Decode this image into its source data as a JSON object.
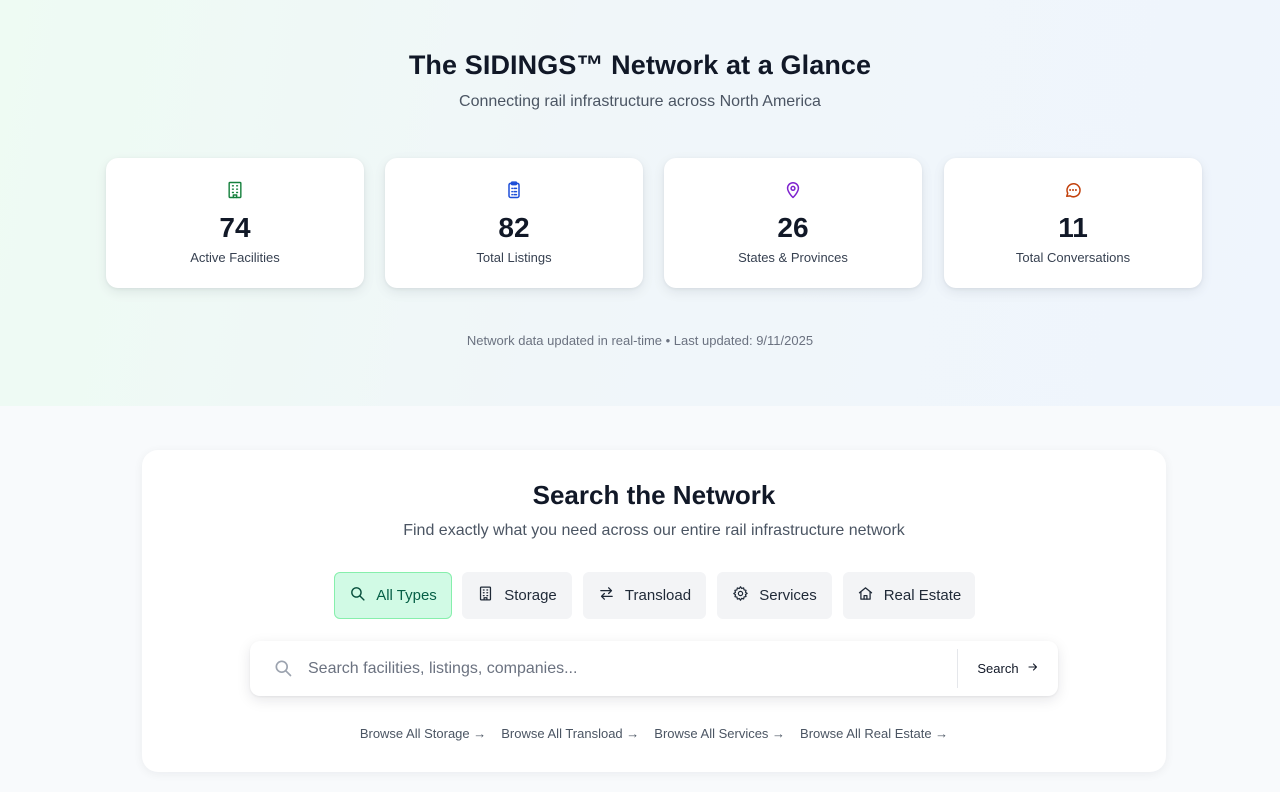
{
  "hero": {
    "title": "The SIDINGS™ Network at a Glance",
    "subtitle": "Connecting rail infrastructure across North America",
    "note": "Network data updated in real-time • Last updated: 9/11/2025",
    "stats": [
      {
        "value": "74",
        "label": "Active Facilities",
        "icon": "building-icon",
        "color": "#15803d"
      },
      {
        "value": "82",
        "label": "Total Listings",
        "icon": "clipboard-list-icon",
        "color": "#1d4ed8"
      },
      {
        "value": "26",
        "label": "States & Provinces",
        "icon": "map-pin-icon",
        "color": "#7e22ce"
      },
      {
        "value": "11",
        "label": "Total Conversations",
        "icon": "message-circle-icon",
        "color": "#c2410c"
      }
    ]
  },
  "search": {
    "title": "Search the Network",
    "subtitle": "Find exactly what you need across our entire rail infrastructure network",
    "types": [
      {
        "label": "All Types",
        "icon": "search-icon",
        "active": true
      },
      {
        "label": "Storage",
        "icon": "building-icon",
        "active": false
      },
      {
        "label": "Transload",
        "icon": "arrows-exchange-icon",
        "active": false
      },
      {
        "label": "Services",
        "icon": "gear-icon",
        "active": false
      },
      {
        "label": "Real Estate",
        "icon": "home-icon",
        "active": false
      }
    ],
    "placeholder": "Search facilities, listings, companies...",
    "value": "",
    "button_label": "Search",
    "browse_links": [
      "Browse All Storage →",
      "Browse All Transload →",
      "Browse All Services →",
      "Browse All Real Estate →"
    ]
  }
}
